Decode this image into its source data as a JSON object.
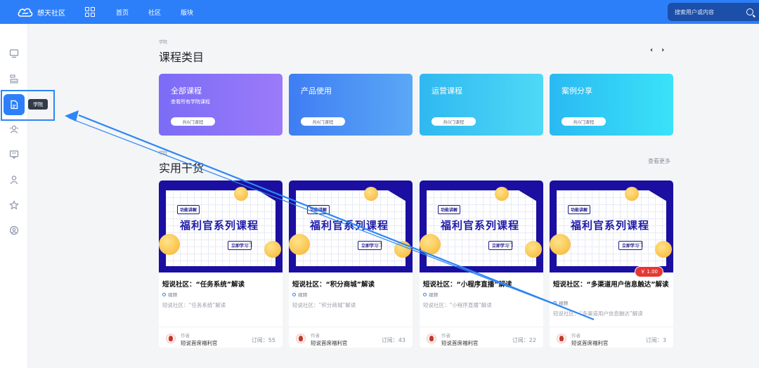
{
  "topbar": {
    "logo_text": "想天社区",
    "nav": [
      "首页",
      "社区",
      "版块"
    ],
    "search_placeholder": "搜索用户或内容"
  },
  "sidebar": {
    "tooltip": "学院"
  },
  "categories_section": {
    "small_label": "学院",
    "title": "课程类目"
  },
  "categories": [
    {
      "name": "全部课程",
      "desc": "查看所有学院课程",
      "count": "共6门课程"
    },
    {
      "name": "产品使用",
      "desc": "",
      "count": "共6门课程"
    },
    {
      "name": "运营课程",
      "desc": "",
      "count": "共0门课程"
    },
    {
      "name": "案例分享",
      "desc": "",
      "count": "共0门课程"
    }
  ],
  "practical_section": {
    "small_label": "学院",
    "title": "实用干货",
    "more": "查看更多"
  },
  "cover": {
    "tag": "功能讲解",
    "title": "福利官系列课程",
    "button": "立即学习"
  },
  "courses": [
    {
      "title": "短说社区：“任务系统”解读",
      "type": "视频",
      "desc": "短说社区：“任务系统”解读",
      "author_label": "作者",
      "author": "短说首席福利官",
      "subs": "订阅：55",
      "price": ""
    },
    {
      "title": "短说社区：“积分商城”解读",
      "type": "视频",
      "desc": "短说社区：“积分商城”解读",
      "author_label": "作者",
      "author": "短说首席福利官",
      "subs": "订阅：43",
      "price": ""
    },
    {
      "title": "短说社区：“小程序直播”解读",
      "type": "视频",
      "desc": "短说社区：“小程序直播”解读",
      "author_label": "作者",
      "author": "短说首席福利官",
      "subs": "订阅：22",
      "price": ""
    },
    {
      "title": "短说社区：“多渠道用户信息触达”解读",
      "type": "视频",
      "desc": "短说社区：“多渠道用户信息触达”解读",
      "author_label": "作者",
      "author": "短说首席福利官",
      "subs": "订阅：3",
      "price": "￥ 1.00"
    }
  ],
  "colors": {
    "primary": "#2d7ff9",
    "cover_bg": "#1a0fa0",
    "cat1": [
      "#7b6cf6",
      "#9b7bf9"
    ],
    "cat2": [
      "#3f7df3",
      "#5aa8f6"
    ],
    "cat3": [
      "#2fb8f0",
      "#4fd9f6"
    ],
    "cat4": [
      "#2ab9f2",
      "#3ae3f8"
    ],
    "price": "#e53935"
  }
}
